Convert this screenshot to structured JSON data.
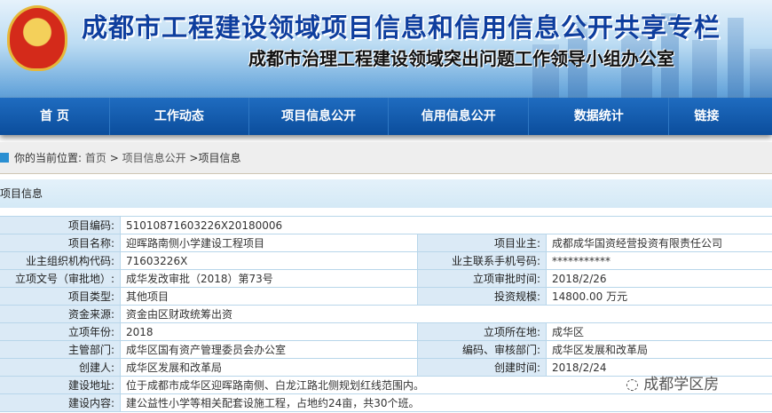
{
  "header": {
    "title": "成都市工程建设领域项目信息和信用信息公开共享专栏",
    "subtitle": "成都市治理工程建设领域突出问题工作领导小组办公室"
  },
  "nav": [
    "首 页",
    "工作动态",
    "项目信息公开",
    "信用信息公开",
    "数据统计",
    "链接"
  ],
  "breadcrumb": {
    "prefix": "你的当前位置:",
    "items": [
      "首页",
      " > ",
      "项目信息公开",
      " >项目信息"
    ]
  },
  "section_title": "项目信息",
  "rows": [
    {
      "l1": "项目编码:",
      "v1": "51010871603226X20180006"
    },
    {
      "l1": "项目名称:",
      "v1": "迎晖路南侧小学建设工程项目",
      "l2": "项目业主:",
      "v2": "成都成华国资经营投资有限责任公司"
    },
    {
      "l1": "业主组织机构代码:",
      "v1": "71603226X",
      "l2": "业主联系手机号码:",
      "v2": "***********"
    },
    {
      "l1": "立项文号（审批地）:",
      "v1": "成华发改审批（2018）第73号",
      "l2": "立项审批时间:",
      "v2": "2018/2/26"
    },
    {
      "l1": "项目类型:",
      "v1": "其他项目",
      "l2": "投资规模:",
      "v2": "14800.00 万元"
    },
    {
      "l1": "资金来源:",
      "v1": "资金由区财政统筹出资"
    },
    {
      "l1": "立项年份:",
      "v1": "2018",
      "l2": "立项所在地:",
      "v2": "成华区"
    },
    {
      "l1": "主管部门:",
      "v1": "成华区国有资产管理委员会办公室",
      "l2": "编码、审核部门:",
      "v2": "成华区发展和改革局"
    },
    {
      "l1": "创建人:",
      "v1": "成华区发展和改革局",
      "l2": "创建时间:",
      "v2": "2018/2/24"
    },
    {
      "l1": "建设地址:",
      "v1": "位于成都市成华区迎晖路南侧、白龙江路北侧规划红线范围内。"
    },
    {
      "l1": "建设内容:",
      "v1": "建公益性小学等相关配套设施工程，占地约24亩，共30个班。"
    }
  ],
  "watermark": "成都学区房"
}
